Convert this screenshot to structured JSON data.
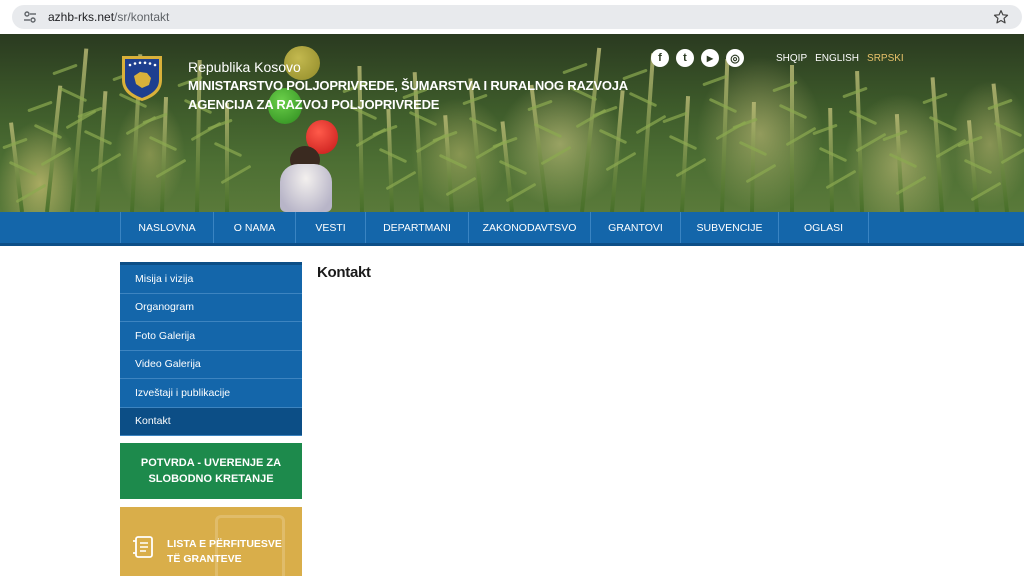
{
  "browser": {
    "url_domain": "azhb-rks.net",
    "url_path": "/sr/kontakt"
  },
  "header": {
    "country": "Republika Kosovo",
    "ministry": "MINISTARSTVO POLJOPRIVREDE, ŠUMARSTVA I RURALNOG RAZVOJA",
    "agency": "AGENCIJA ZA RAZVOJ POLJOPRIVREDE",
    "social": [
      {
        "icon": "facebook-icon",
        "glyph": "f"
      },
      {
        "icon": "twitter-icon",
        "glyph": "t"
      },
      {
        "icon": "youtube-icon",
        "glyph": "▶"
      },
      {
        "icon": "instagram-icon",
        "glyph": "◎"
      }
    ],
    "languages": [
      {
        "label": "SHQIP",
        "active": false
      },
      {
        "label": "ENGLISH",
        "active": false
      },
      {
        "label": "SRPSKI",
        "active": true
      }
    ],
    "active_lang_color": "#e8c26a"
  },
  "nav": {
    "items": [
      "NASLOVNA",
      "O NAMA",
      "VESTI",
      "DEPARTMANI",
      "ZAKONODAVTSVO",
      "GRANTOVI",
      "SUBVENCIJE",
      "OGLASI"
    ],
    "background": "#1466aa"
  },
  "sidebar": {
    "items": [
      "Misija i vizija",
      "Organogram",
      "Foto Galerija",
      "Video Galerija",
      "Izveštaji i publikacije",
      "Kontakt"
    ],
    "active_index": 5
  },
  "promos": {
    "green": "POTVRDA - UVERENJE ZA SLOBODNO KRETANJE",
    "gold": "LISTA E PËRFITUESVE TË GRANTEVE",
    "green_color": "#1d8a4c",
    "gold_color": "#d9ae4a"
  },
  "main": {
    "title": "Kontakt"
  }
}
